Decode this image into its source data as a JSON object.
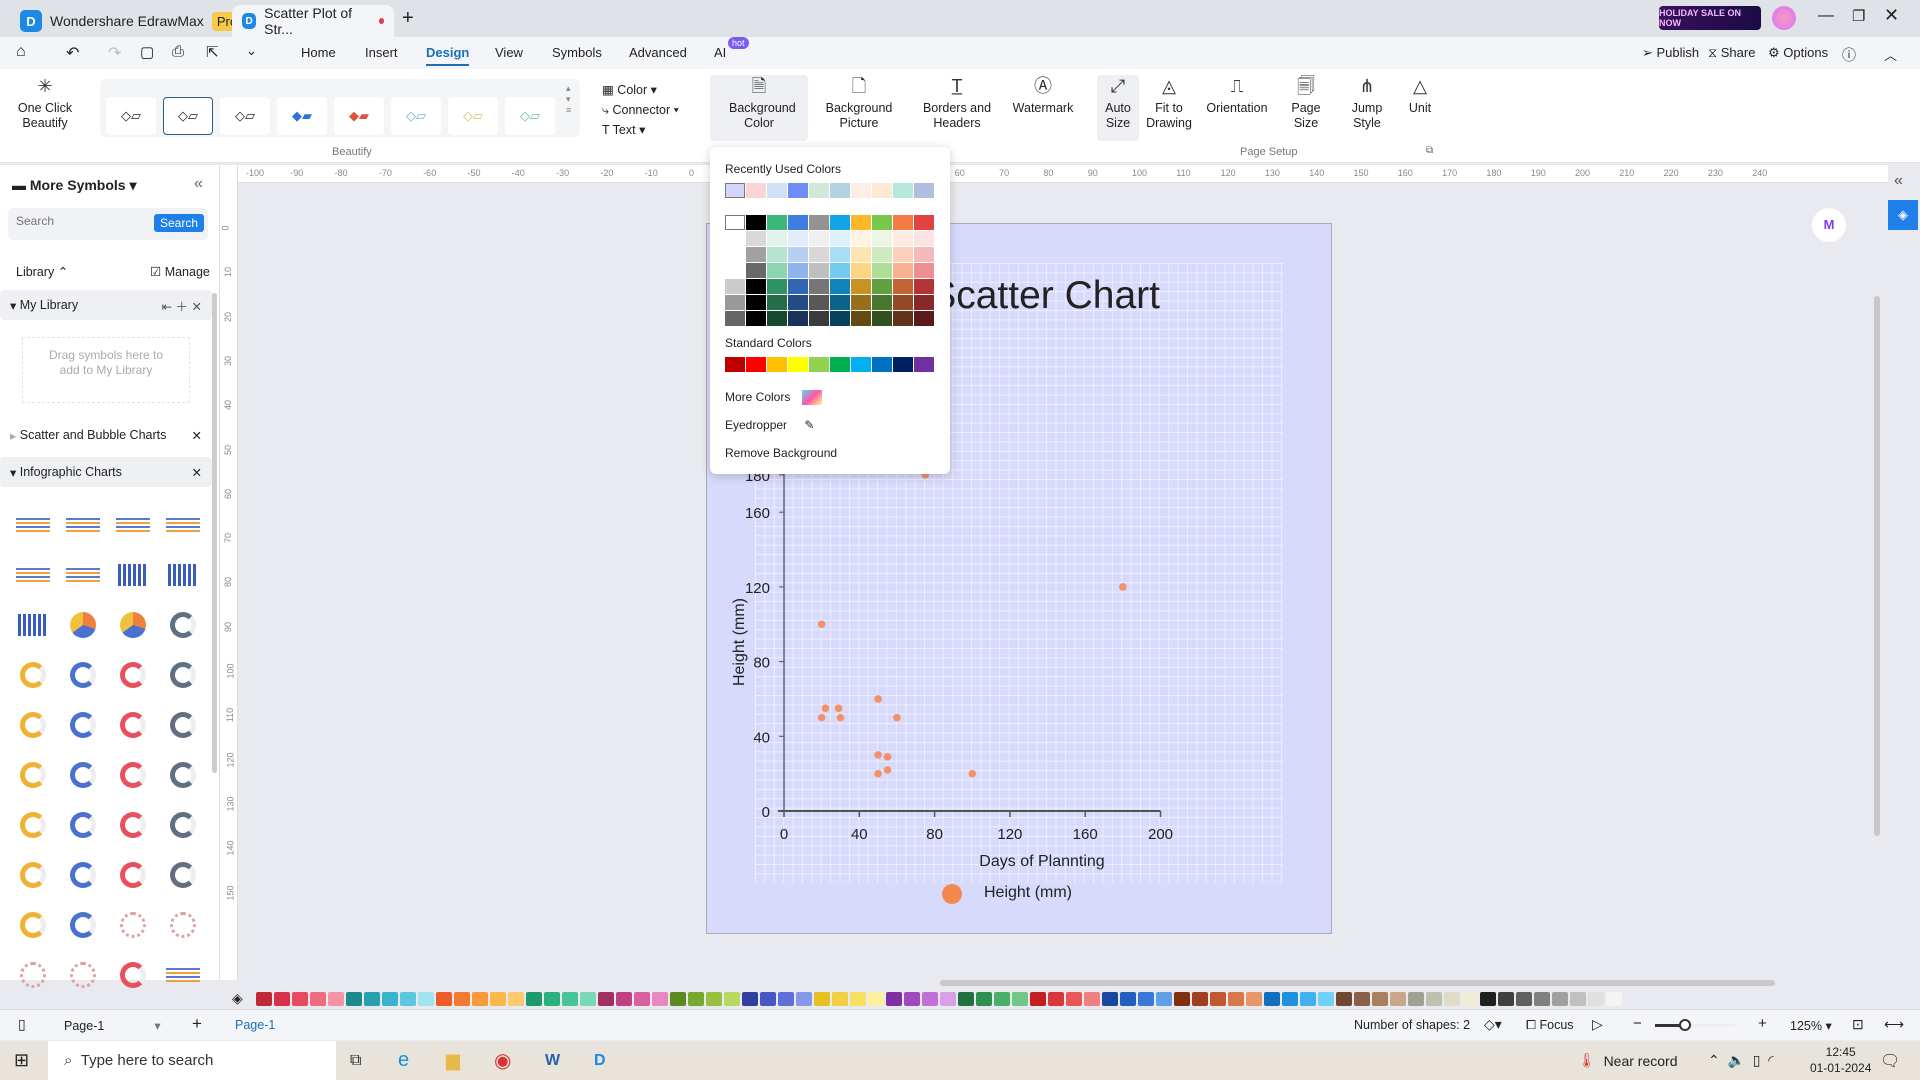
{
  "titlebar": {
    "app_name": "Wondershare EdrawMax",
    "pro_badge": "Pro",
    "doc_tab": "Scatter Plot of Str...",
    "new_tab": "+",
    "promo": "HOLIDAY SALE ON NOW"
  },
  "menu": {
    "tabs": [
      "Home",
      "Insert",
      "Design",
      "View",
      "Symbols",
      "Advanced",
      "AI"
    ],
    "ai_badge": "hot",
    "active": "Design",
    "publish": "Publish",
    "share": "Share",
    "options": "Options"
  },
  "ribbon": {
    "one_click": "One Click Beautify",
    "group_beautify": "Beautify",
    "color": "Color",
    "connector": "Connector",
    "text": "Text",
    "buttons": [
      "Background Color",
      "Background Picture",
      "Borders and Headers",
      "Watermark",
      "Auto Size",
      "Fit to Drawing",
      "Orientation",
      "Page Size",
      "Jump Style",
      "Unit"
    ],
    "group_page_setup": "Page Setup"
  },
  "sidebar": {
    "title": "More Symbols",
    "search_placeholder": "Search",
    "search_button": "Search",
    "library": "Library",
    "manage": "Manage",
    "my_library": "My Library",
    "drop_hint": "Drag symbols here to add to My Library",
    "sections": [
      "Scatter and Bubble Charts",
      "Infographic Charts"
    ]
  },
  "color_dropdown": {
    "recent_label": "Recently Used Colors",
    "recent": [
      "#d3d6fa",
      "#fbd5d5",
      "#cfe0f7",
      "#6d8cf5",
      "#cfe8d8",
      "#b4d3e0",
      "#fbeee4",
      "#fde9d1",
      "#b7e6da",
      "#b3bde0"
    ],
    "theme_top": [
      "#ffffff",
      "#000000",
      "#3ab77a",
      "#3f7ee0",
      "#939393",
      "#11a5e8",
      "#fbb82a",
      "#78c84e",
      "#f47c44",
      "#e14244"
    ],
    "standard_label": "Standard Colors",
    "standard": [
      "#c00000",
      "#ff0000",
      "#ffc000",
      "#ffff00",
      "#92d050",
      "#00b050",
      "#00b0f0",
      "#0070c0",
      "#002060",
      "#7030a0"
    ],
    "more_colors": "More Colors",
    "eyedropper": "Eyedropper",
    "remove_background": "Remove Background"
  },
  "chart_data": {
    "type": "scatter",
    "title": "Scatter Chart",
    "xlabel": "Days of Plannting",
    "ylabel": "Height (mm)",
    "xlim": [
      0,
      200
    ],
    "ylim": [
      0,
      180
    ],
    "xticks": [
      0,
      40,
      80,
      120,
      160,
      200
    ],
    "yticks": [
      0,
      40,
      80,
      120,
      160,
      180
    ],
    "grid": true,
    "legend": "bottom",
    "background": "#d8dafc",
    "marker_color": "#f4916a",
    "series": [
      {
        "name": "Height (mm)",
        "points": [
          [
            20,
            100
          ],
          [
            75,
            180
          ],
          [
            180,
            120
          ],
          [
            20,
            50
          ],
          [
            22,
            55
          ],
          [
            29,
            55
          ],
          [
            30,
            50
          ],
          [
            50,
            60
          ],
          [
            60,
            50
          ],
          [
            50,
            30
          ],
          [
            55,
            29
          ],
          [
            55,
            22
          ],
          [
            50,
            20
          ],
          [
            100,
            20
          ]
        ]
      }
    ]
  },
  "statusbar": {
    "page_select": "Page-1",
    "page_tab": "Page-1",
    "shapes": "Number of shapes: 2",
    "focus": "Focus",
    "zoom": "125%"
  },
  "taskbar": {
    "search": "Type here to search",
    "weather": "Near record",
    "time": "12:45",
    "date": "01-01-2024"
  }
}
